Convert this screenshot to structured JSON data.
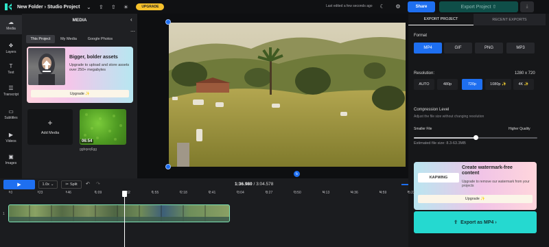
{
  "topbar": {
    "breadcrumb": "New Folder › Studio Project",
    "upgrade_label": "UPGRADE",
    "last_edited": "Last edited a few seconds ago",
    "share_label": "Share",
    "export_label": "Export Project ⇧",
    "download_icon": "download-icon"
  },
  "nav": {
    "items": [
      {
        "label": "Media",
        "icon": "☁"
      },
      {
        "label": "Layers",
        "icon": "❖"
      },
      {
        "label": "Text",
        "icon": "T"
      },
      {
        "label": "Transcript",
        "icon": "☰"
      },
      {
        "label": "Subtitles",
        "icon": "▭"
      },
      {
        "label": "Videos",
        "icon": "▶"
      },
      {
        "label": "Images",
        "icon": "▣"
      }
    ]
  },
  "media": {
    "title": "MEDIA",
    "tabs": [
      "This Project",
      "My Media",
      "Google Photos"
    ],
    "promo_title": "Bigger, bolder assets",
    "promo_text": "Upgrade to upload and store assets over 250+ megabytes",
    "promo_button": "Upgrade ✨",
    "add_media_label": "Add Media",
    "thumb_duration": "06:54",
    "thumb_name": "ggbqeq6gg"
  },
  "timeline": {
    "speed": "1.0x",
    "split_label": "Split",
    "current_time": "1:36.980",
    "total_time": "3:04.578",
    "ticks": [
      ":0",
      ":23",
      ":46",
      "1:09",
      "1:32",
      "1:55",
      "2:18",
      "2:41",
      "3:04",
      "3:27",
      "3:50",
      "4:13",
      "4:36",
      "4:59",
      "5:22"
    ],
    "track_number": "1",
    "playhead_fraction": 0.31
  },
  "export": {
    "tabs": [
      "EXPORT PROJECT",
      "RECENT EXPORTS"
    ],
    "format_label": "Format",
    "formats": [
      "MP4",
      "GIF",
      "PNG",
      "MP3"
    ],
    "selected_format": "MP4",
    "resolution_label": "Resolution:",
    "resolution_value": "1280 x 720",
    "resolutions": [
      "AUTO",
      "480p",
      "720p",
      "1080p ✨",
      "4K ✨"
    ],
    "selected_resolution": "720p",
    "compression_label": "Compression Level",
    "compression_hint": "Adjust the file size without changing resolution",
    "smaller_file": "Smaller File",
    "higher_quality": "Higher Quality",
    "compression_level": 0.5,
    "estimated_size": "Estimated file size: 8.3-63.3MB",
    "wm_title": "Create watermark-free content",
    "wm_text": "Upgrade to remove our watermark from your projects",
    "wm_logo": "KAPWING",
    "wm_button": "Upgrade ✨",
    "export_button": "Export as MP4 ›"
  },
  "colors": {
    "accent": "#1e6ff0",
    "export_teal": "#25d9d0",
    "upgrade_yellow": "#f6c12c"
  }
}
